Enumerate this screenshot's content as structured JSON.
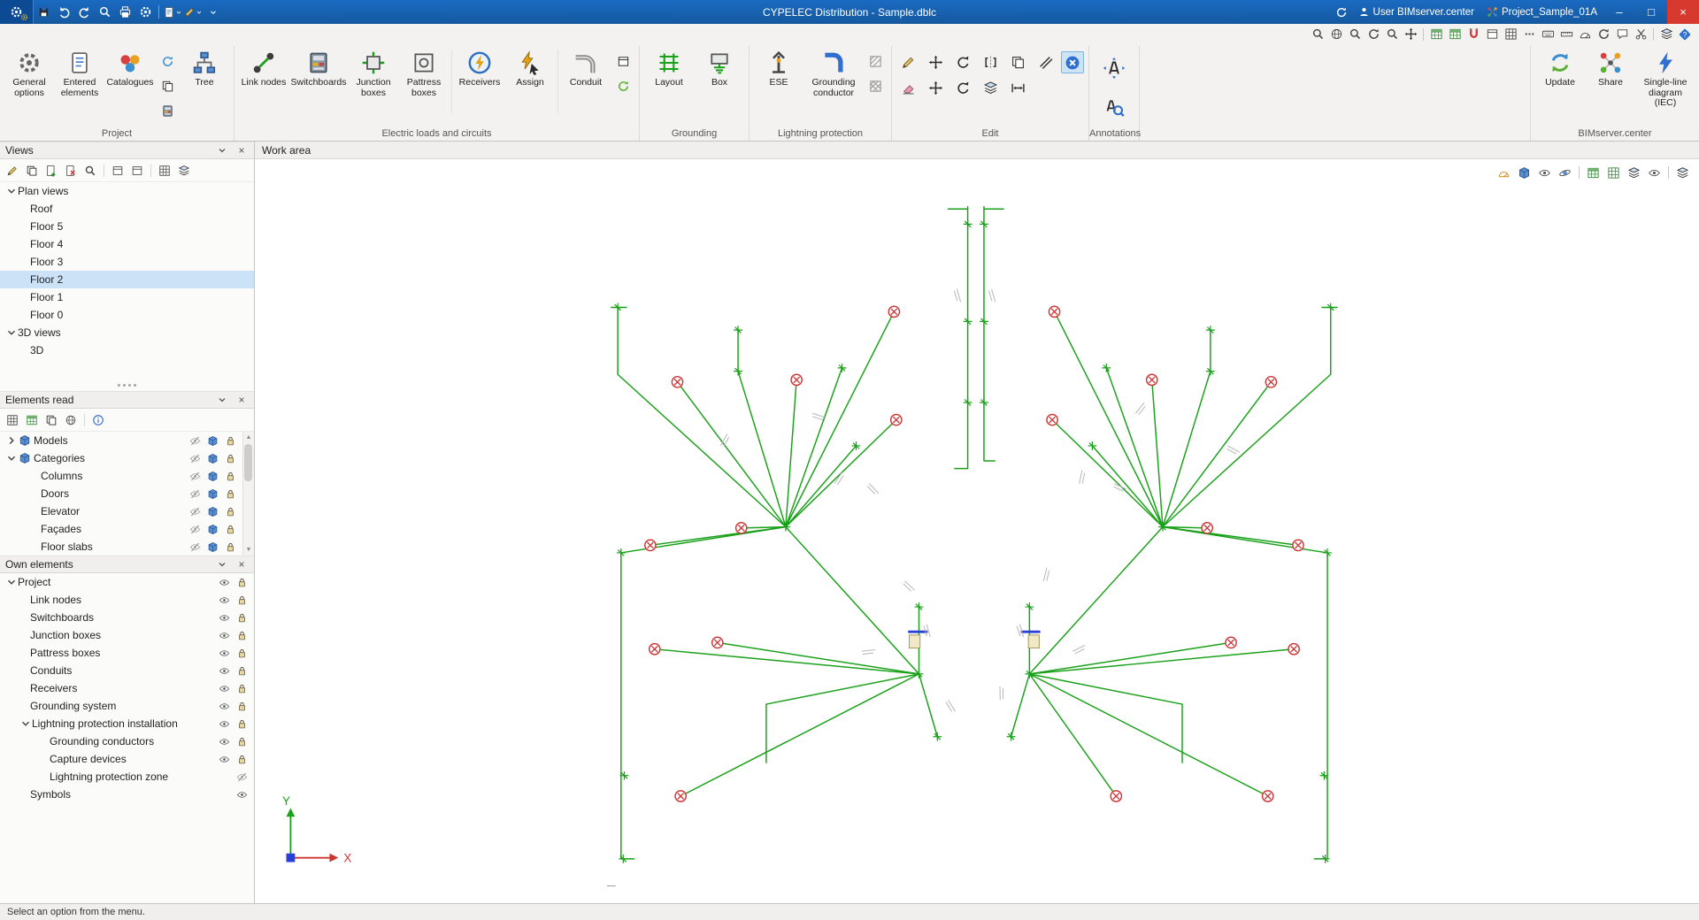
{
  "titlebar": {
    "title": "CYPELEC Distribution - Sample.dblc",
    "user": "User BIMserver.center",
    "project": "Project_Sample_01A"
  },
  "ribbon": {
    "groups": {
      "project": "Project",
      "loads": "Electric loads and circuits",
      "grounding": "Grounding",
      "lightning": "Lightning protection",
      "edit": "Edit",
      "annotations": "Annotations",
      "bimserver": "BIMserver.center"
    },
    "buttons": {
      "general_options": "General options",
      "entered_elements": "Entered elements",
      "catalogues": "Catalogues",
      "tree": "Tree",
      "link_nodes": "Link nodes",
      "switchboards": "Switchboards",
      "junction_boxes": "Junction boxes",
      "pattress_boxes": "Pattress boxes",
      "receivers": "Receivers",
      "assign": "Assign",
      "conduit": "Conduit",
      "layout": "Layout",
      "box": "Box",
      "ese": "ESE",
      "grounding_conductor": "Grounding conductor",
      "update": "Update",
      "share": "Share",
      "single_line_diagram": "Single-line diagram (IEC)"
    }
  },
  "views_panel": {
    "title": "Views",
    "items": [
      {
        "label": "Plan views"
      },
      {
        "label": "Roof"
      },
      {
        "label": "Floor 5"
      },
      {
        "label": "Floor 4"
      },
      {
        "label": "Floor 3"
      },
      {
        "label": "Floor 2"
      },
      {
        "label": "Floor 1"
      },
      {
        "label": "Floor 0"
      },
      {
        "label": "3D views"
      },
      {
        "label": "3D"
      }
    ]
  },
  "elements_read_panel": {
    "title": "Elements read",
    "items": [
      {
        "label": "Models"
      },
      {
        "label": "Categories"
      },
      {
        "label": "Columns"
      },
      {
        "label": "Doors"
      },
      {
        "label": "Elevator"
      },
      {
        "label": "Façades"
      },
      {
        "label": "Floor slabs"
      }
    ]
  },
  "own_elements_panel": {
    "title": "Own elements",
    "items": [
      {
        "label": "Project"
      },
      {
        "label": "Link nodes"
      },
      {
        "label": "Switchboards"
      },
      {
        "label": "Junction boxes"
      },
      {
        "label": "Pattress boxes"
      },
      {
        "label": "Conduits"
      },
      {
        "label": "Receivers"
      },
      {
        "label": "Grounding system"
      },
      {
        "label": "Lightning protection installation"
      },
      {
        "label": "Grounding conductors"
      },
      {
        "label": "Capture devices"
      },
      {
        "label": "Lightning protection zone"
      },
      {
        "label": "Symbols"
      }
    ]
  },
  "workarea": {
    "tab": "Work area"
  },
  "axes": {
    "x": "X",
    "y": "Y"
  },
  "statusbar": {
    "message": "Select an option from the menu."
  }
}
